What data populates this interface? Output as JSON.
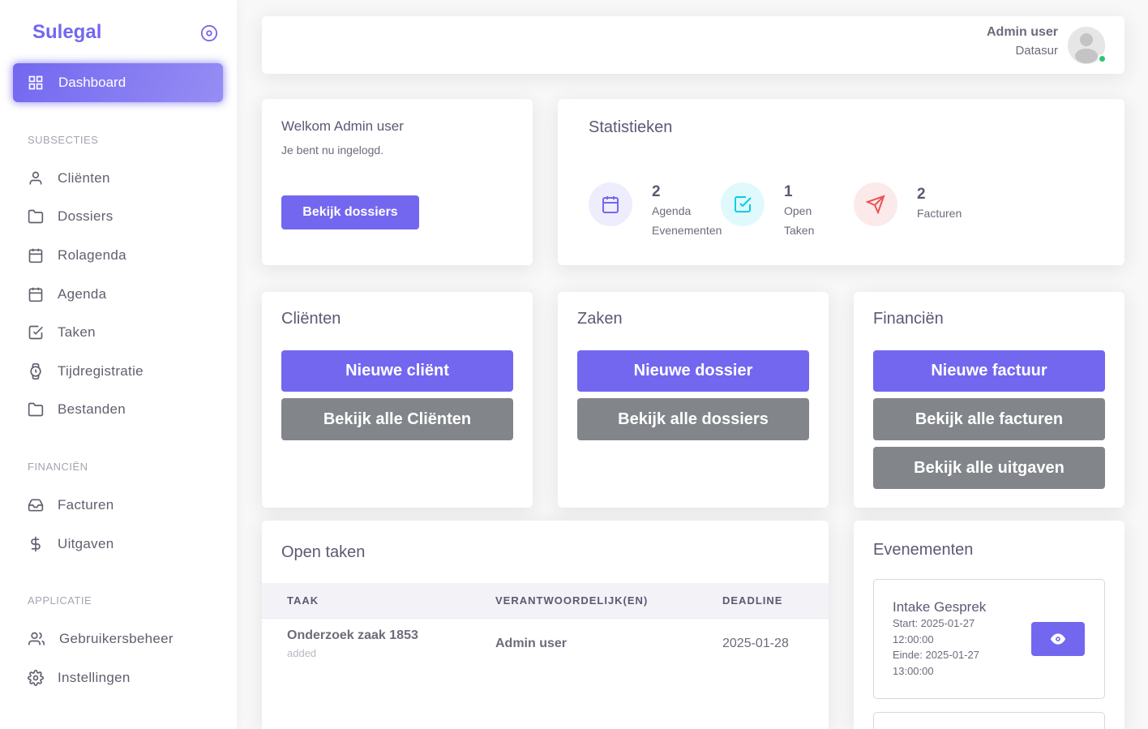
{
  "sidebar": {
    "brand": "Sulegal",
    "active": {
      "label": "Dashboard",
      "icon": "grid-icon"
    },
    "sections": [
      {
        "title": "SUBSECTIES"
      },
      {
        "title": "FINANCIËN"
      },
      {
        "title": "APPLICATIE"
      }
    ],
    "items": [
      {
        "label": "Cliënten",
        "icon": "user-icon"
      },
      {
        "label": "Dossiers",
        "icon": "folder-icon"
      },
      {
        "label": "Rolagenda",
        "icon": "calendar-icon"
      },
      {
        "label": "Agenda",
        "icon": "calendar-icon"
      },
      {
        "label": "Taken",
        "icon": "check-square-icon"
      },
      {
        "label": "Tijdregistratie",
        "icon": "watch-icon"
      },
      {
        "label": "Bestanden",
        "icon": "folder-icon"
      },
      {
        "label": "Facturen",
        "icon": "inbox-icon"
      },
      {
        "label": "Uitgaven",
        "icon": "dollar-icon"
      },
      {
        "label": "Gebruikersbeheer",
        "icon": "users-icon"
      },
      {
        "label": "Instellingen",
        "icon": "settings-icon"
      }
    ]
  },
  "header": {
    "user_name": "Admin user",
    "user_org": "Datasur",
    "status_color": "#28c76f"
  },
  "welcome": {
    "title": "Welkom Admin user",
    "subtitle": "Je bent nu ingelogd.",
    "button": "Bekijk dossiers"
  },
  "stats": {
    "title": "Statistieken",
    "items": [
      {
        "value": "2",
        "label_line1": "Agenda",
        "label_line2": "Evenementen",
        "icon": "calendar-icon",
        "color": "#7367f0"
      },
      {
        "value": "1",
        "label_line1": "Open",
        "label_line2": "Taken",
        "icon": "check-square-icon",
        "color": "#00cfe8"
      },
      {
        "value": "2",
        "label_line1": "Facturen",
        "label_line2": "",
        "icon": "send-icon",
        "color": "#ea5455"
      }
    ]
  },
  "clients": {
    "title": "Cliënten",
    "primary": "Nieuwe cliënt",
    "secondary": "Bekijk alle Cliënten"
  },
  "cases": {
    "title": "Zaken",
    "primary": "Nieuwe dossier",
    "secondary": "Bekijk alle dossiers"
  },
  "finance": {
    "title": "Financiën",
    "primary": "Nieuwe factuur",
    "secondary": "Bekijk alle facturen",
    "tertiary": "Bekijk alle uitgaven"
  },
  "tasks": {
    "title": "Open taken",
    "columns": [
      "TAAK",
      "VERANTWOORDELIJK(EN)",
      "DEADLINE"
    ],
    "rows": [
      {
        "task": "Onderzoek zaak 1853",
        "status": "added",
        "owner": "Admin user",
        "deadline": "2025-01-28"
      }
    ]
  },
  "events": {
    "title": "Evenementen",
    "items": [
      {
        "title": "Intake Gesprek",
        "start_label": "Start: 2025-01-27",
        "start_time": "12:00:00",
        "end_label": "Einde: 2025-01-27",
        "end_time": "13:00:00",
        "action_icon": "eye-icon"
      }
    ]
  },
  "colors": {
    "primary": "#7367f0",
    "secondary": "#82868b"
  }
}
